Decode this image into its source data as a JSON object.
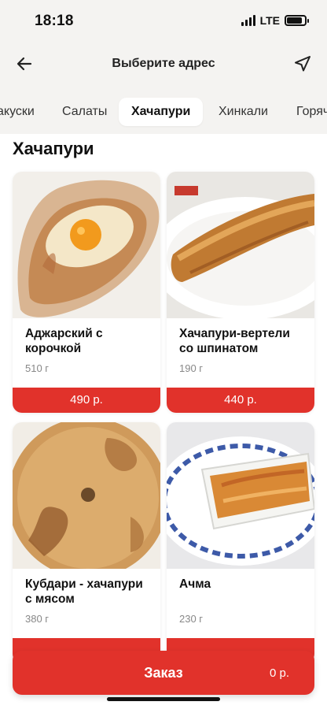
{
  "status_bar": {
    "time": "18:18",
    "network": "LTE",
    "battery_level": 0.85
  },
  "header": {
    "title": "Выберите адрес",
    "back_icon": "arrow-left-icon",
    "location_icon": "navigation-arrow-icon"
  },
  "tabs": [
    {
      "label": "акуски",
      "active": false
    },
    {
      "label": "Салаты",
      "active": false
    },
    {
      "label": "Хачапури",
      "active": true
    },
    {
      "label": "Хинкали",
      "active": false
    },
    {
      "label": "Горяч",
      "active": false
    }
  ],
  "section": {
    "title": "Хачапури"
  },
  "products": [
    {
      "name": "Аджарский с корочкой",
      "weight": "510 г",
      "price": "490 р."
    },
    {
      "name": "Хачапури-вертели со шпинатом",
      "weight": "190 г",
      "price": "440 р."
    },
    {
      "name": "Кубдари - хачапури с мясом",
      "weight": "380 г",
      "price": ""
    },
    {
      "name": "Ачма",
      "weight": "230 г",
      "price": ""
    }
  ],
  "order": {
    "label": "Заказ",
    "total": "0 р."
  },
  "colors": {
    "accent": "#e1322b",
    "background": "#f4f3f1"
  }
}
